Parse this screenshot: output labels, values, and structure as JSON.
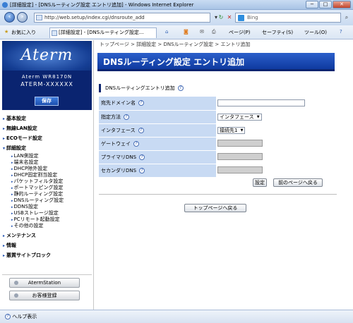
{
  "window": {
    "title": "[詳細設定] - [DNSルーティング設定 エントリ追加] - Windows Internet Explorer",
    "min": "−",
    "max": "□",
    "close": "✕"
  },
  "address": {
    "url": "http://web.setup/index.cgi/dnsroute_add",
    "search_placeholder": "Bing"
  },
  "favbar": {
    "favorites": "お気に入り",
    "tab": "[詳細設定] - [DNSルーティング設定...",
    "page_menu": "ページ(P)",
    "safety_menu": "セーフティ(S)",
    "tools_menu": "ツール(O)"
  },
  "sidebar": {
    "logo": "Aterm",
    "model_line1": "Aterm WR8170N",
    "model_line2": "ATERM-XXXXXX",
    "save": "保存",
    "menu": [
      {
        "label": "基本設定"
      },
      {
        "label": "無線LAN設定"
      },
      {
        "label": "ECOモード設定"
      },
      {
        "label": "詳細設定"
      }
    ],
    "submenu": [
      {
        "label": "LAN側設定"
      },
      {
        "label": "端末名設定"
      },
      {
        "label": "DHCP除外設定"
      },
      {
        "label": "DHCP固定割当設定"
      },
      {
        "label": "パケットフィルタ設定"
      },
      {
        "label": "ポートマッピング設定"
      },
      {
        "label": "静的ルーティング設定"
      },
      {
        "label": "DNSルーティング設定"
      },
      {
        "label": "DDNS設定"
      },
      {
        "label": "USBストレージ設定"
      },
      {
        "label": "PCリモート起動設定"
      },
      {
        "label": "その他の設定"
      }
    ],
    "menu2": [
      {
        "label": "メンテナンス"
      },
      {
        "label": "情報"
      },
      {
        "label": "悪質サイトブロック"
      }
    ],
    "aterm_station": "AtermStation",
    "support": "お客様登録",
    "help": "ヘルプ表示"
  },
  "main": {
    "breadcrumb": "トップページ > 詳細設定 > DNSルーティング設定 > エントリ追加",
    "title": "DNSルーティング設定 エントリ追加",
    "section": "DNSルーティングエントリ追加",
    "fields": [
      {
        "label": "宛先ドメイン名",
        "value": ""
      },
      {
        "label": "指定方法",
        "value": "インタフェース"
      },
      {
        "label": "インタフェース",
        "value": "接続先1"
      },
      {
        "label": "ゲートウェイ",
        "value": ""
      },
      {
        "label": "プライマリDNS",
        "value": ""
      },
      {
        "label": "セカンダリDNS",
        "value": ""
      }
    ],
    "apply": "設定",
    "back": "前のページへ戻る",
    "top": "トップページへ戻る"
  }
}
